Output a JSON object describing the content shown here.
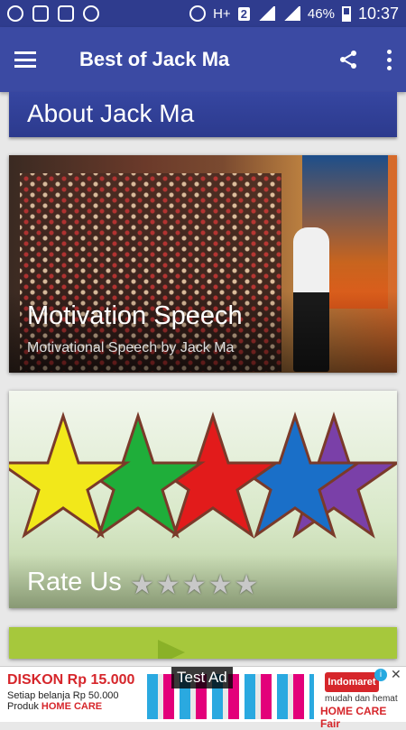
{
  "status_bar": {
    "battery": "46%",
    "time": "10:37",
    "sim_badge": "2",
    "network": "H+",
    "icons": [
      "whatsapp-icon",
      "image-icon",
      "link-icon",
      "wifi-icon",
      "alarm-icon",
      "signal-icon",
      "battery-icon"
    ]
  },
  "app_bar": {
    "title": "Best of Jack Ma",
    "icons": [
      "menu-icon",
      "share-icon",
      "more-vert-icon"
    ]
  },
  "section": {
    "title": "About Jack Ma"
  },
  "cards": [
    {
      "title": "Motivation Speech",
      "subtitle": "Motivational Speech by Jack Ma"
    },
    {
      "title": "Rate Us",
      "stars": 5
    }
  ],
  "ad": {
    "label": "Test Ad",
    "title": "DISKON Rp 15.000",
    "line1": "Setiap belanja Rp 50.000",
    "line2_prefix": "Produk ",
    "line2_highlight": "HOME CARE",
    "brand": "Indomaret",
    "brand_sub": "mudah dan hemat",
    "brand_sub2": "HOME CARE Fair"
  },
  "colors": {
    "primary": "#3b4aa3",
    "status": "#2f3c8e",
    "accent_red": "#d6262b"
  }
}
